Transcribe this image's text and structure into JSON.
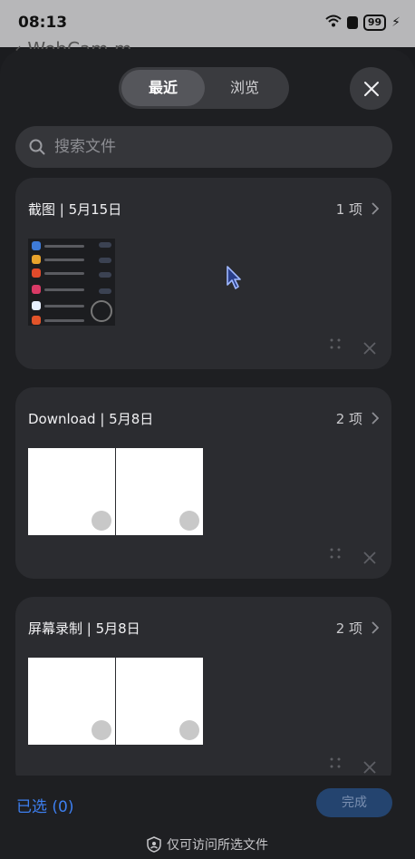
{
  "status": {
    "time": "08:13",
    "battery": "99"
  },
  "behind_app": {
    "title": "WebCam.m"
  },
  "tabs": {
    "recent": "最近",
    "browse": "浏览"
  },
  "search": {
    "placeholder": "搜索文件"
  },
  "albums": [
    {
      "title": "截图 | 5月15日",
      "count": "1 项"
    },
    {
      "title": "Download | 5月8日",
      "count": "2 项"
    },
    {
      "title": "屏幕录制 | 5月8日",
      "count": "2 项"
    }
  ],
  "footer": {
    "selected": "已选 (0)",
    "done": "完成",
    "privacy": "仅可访问所选文件"
  },
  "colors": {
    "accent": "#3d7ff0",
    "sheet": "#1e1f22",
    "card": "#2b2c30"
  }
}
